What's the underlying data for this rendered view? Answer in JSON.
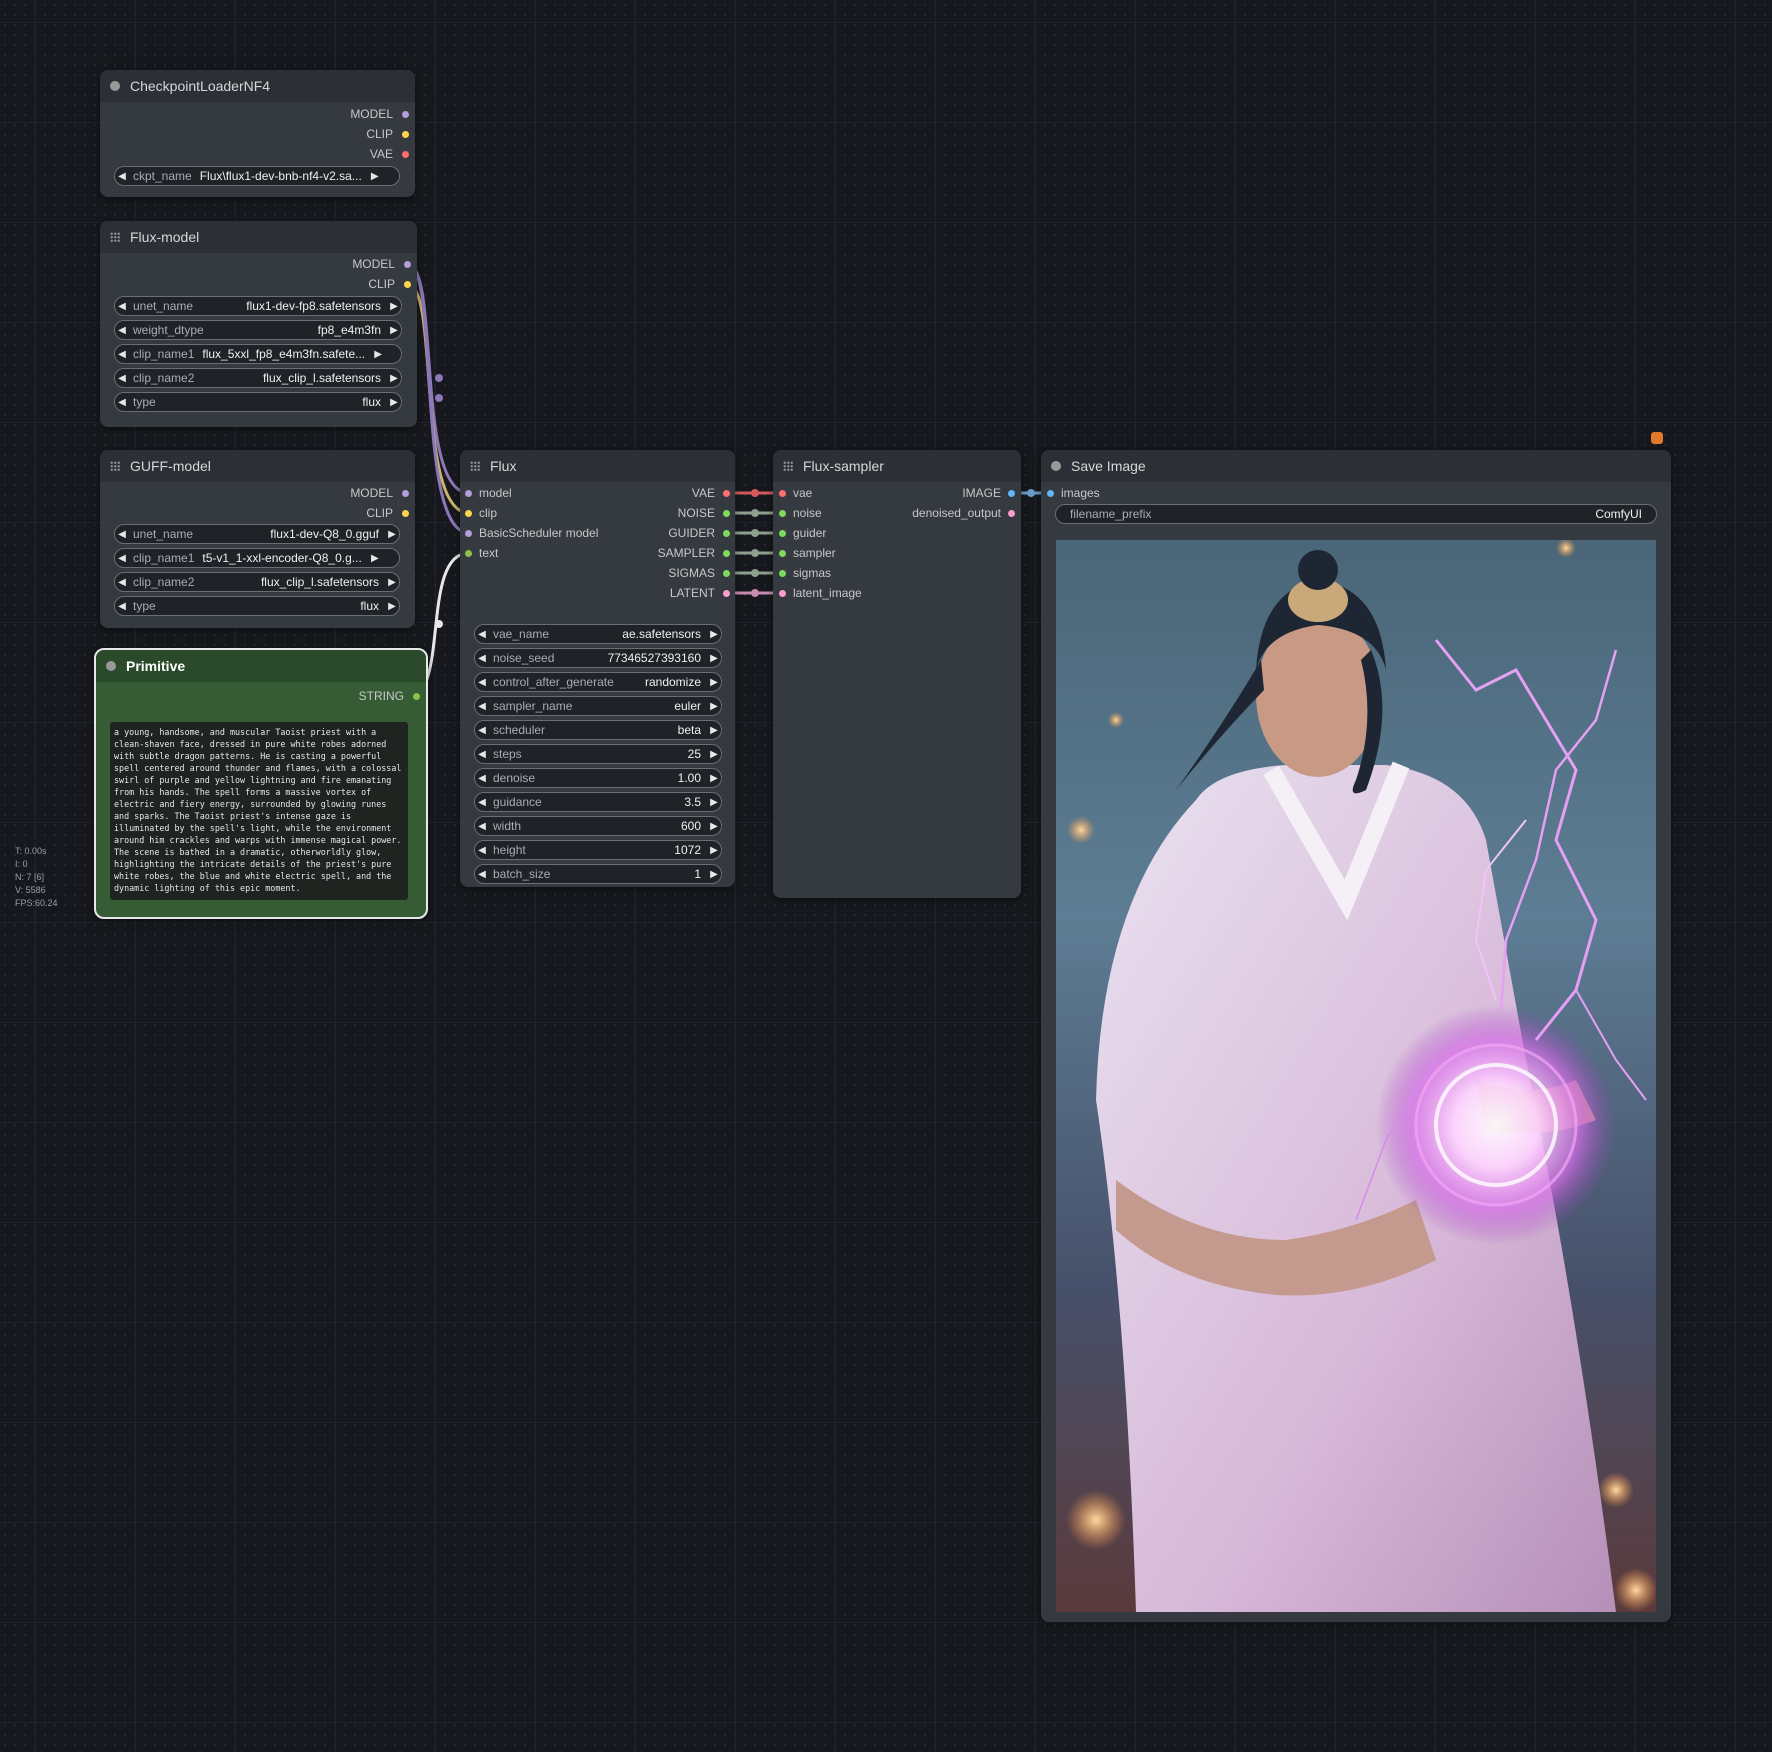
{
  "stats": [
    "T: 0.00s",
    "I: 0",
    "N: 7 [6]",
    "V: 5586",
    "FPS:60.24"
  ],
  "checkpoint": {
    "title": "CheckpointLoaderNF4",
    "outputs": [
      "MODEL",
      "CLIP",
      "VAE"
    ],
    "widgets": [
      {
        "label": "ckpt_name",
        "value": "Flux\\flux1-dev-bnb-nf4-v2.sa..."
      }
    ]
  },
  "flux_model": {
    "title": "Flux-model",
    "outputs": [
      "MODEL",
      "CLIP"
    ],
    "widgets": [
      {
        "label": "unet_name",
        "value": "flux1-dev-fp8.safetensors"
      },
      {
        "label": "weight_dtype",
        "value": "fp8_e4m3fn"
      },
      {
        "label": "clip_name1",
        "value": "flux_5xxl_fp8_e4m3fn.safete..."
      },
      {
        "label": "clip_name2",
        "value": "flux_clip_l.safetensors"
      },
      {
        "label": "type",
        "value": "flux"
      }
    ]
  },
  "guff_model": {
    "title": "GUFF-model",
    "outputs": [
      "MODEL",
      "CLIP"
    ],
    "widgets": [
      {
        "label": "unet_name",
        "value": "flux1-dev-Q8_0.gguf"
      },
      {
        "label": "clip_name1",
        "value": "t5-v1_1-xxl-encoder-Q8_0.g..."
      },
      {
        "label": "clip_name2",
        "value": "flux_clip_l.safetensors"
      },
      {
        "label": "type",
        "value": "flux"
      }
    ]
  },
  "primitive": {
    "title": "Primitive",
    "output": "STRING",
    "text": "a young, handsome, and muscular Taoist priest with a clean-shaven face, dressed in pure white robes adorned with subtle dragon patterns. He is casting a powerful spell centered around thunder and flames, with a colossal swirl of purple and yellow lightning and fire emanating from his hands. The spell forms a massive vortex of electric and fiery energy, surrounded by glowing runes and sparks. The Taoist priest's intense gaze is illuminated by the spell's light, while the environment around him crackles and warps with immense magical power. The scene is bathed in a dramatic, otherworldly glow, highlighting the intricate details of the priest's pure white robes, the blue and white electric spell, and the dynamic lighting of this epic moment."
  },
  "flux": {
    "title": "Flux",
    "inputs": [
      "model",
      "clip",
      "BasicScheduler model",
      "text"
    ],
    "outputs": [
      "VAE",
      "NOISE",
      "GUIDER",
      "SAMPLER",
      "SIGMAS",
      "LATENT"
    ],
    "widgets": [
      {
        "label": "vae_name",
        "value": "ae.safetensors"
      },
      {
        "label": "noise_seed",
        "value": "77346527393160"
      },
      {
        "label": "control_after_generate",
        "value": "randomize"
      },
      {
        "label": "sampler_name",
        "value": "euler"
      },
      {
        "label": "scheduler",
        "value": "beta"
      },
      {
        "label": "steps",
        "value": "25"
      },
      {
        "label": "denoise",
        "value": "1.00"
      },
      {
        "label": "guidance",
        "value": "3.5"
      },
      {
        "label": "width",
        "value": "600"
      },
      {
        "label": "height",
        "value": "1072"
      },
      {
        "label": "batch_size",
        "value": "1"
      }
    ]
  },
  "sampler": {
    "title": "Flux-sampler",
    "inputs": [
      "vae",
      "noise",
      "guider",
      "sampler",
      "sigmas",
      "latent_image"
    ],
    "outputs": [
      "IMAGE",
      "denoised_output"
    ]
  },
  "save": {
    "title": "Save Image",
    "input": "images",
    "widget": {
      "label": "filename_prefix",
      "value": "ComfyUI"
    }
  },
  "colors": {
    "model": "#b39ddb",
    "clip": "#ffd54f",
    "vae": "#ff6e6e",
    "green": "#7cdb5a",
    "latent": "#ff9ccf",
    "image": "#64b5f6",
    "string": "#8bc34a"
  }
}
